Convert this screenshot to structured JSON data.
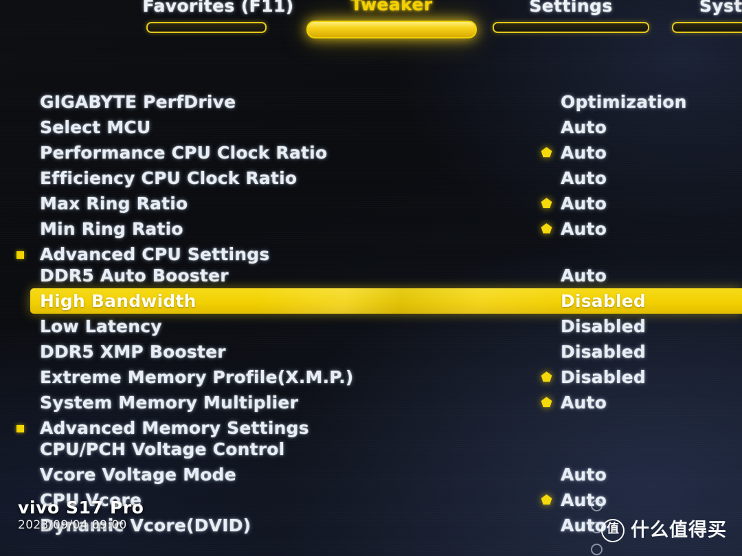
{
  "theme": {
    "accent": "#f2d000",
    "text": "#e9eef4",
    "background": "#0b0d12",
    "selected_row_bg": "#f2d000",
    "selected_row_text": "#fffef2"
  },
  "tabs": [
    {
      "label": "Favorites (F11)",
      "active": false
    },
    {
      "label": "Tweaker",
      "active": true
    },
    {
      "label": "Settings",
      "active": false
    },
    {
      "label": "Syste",
      "active": false
    }
  ],
  "rows": [
    {
      "label": "GIGABYTE PerfDrive",
      "value": "Optimization",
      "star": false,
      "bullet": false,
      "selected": false
    },
    {
      "label": "Select MCU",
      "value": "Auto",
      "star": false,
      "bullet": false,
      "selected": false
    },
    {
      "label": "Performance CPU Clock Ratio",
      "value": "Auto",
      "star": true,
      "bullet": false,
      "selected": false
    },
    {
      "label": "Efficiency CPU Clock Ratio",
      "value": "Auto",
      "star": false,
      "bullet": false,
      "selected": false
    },
    {
      "label": "Max Ring Ratio",
      "value": "Auto",
      "star": true,
      "bullet": false,
      "selected": false
    },
    {
      "label": "Min Ring Ratio",
      "value": "Auto",
      "star": true,
      "bullet": false,
      "selected": false
    },
    {
      "label": "Advanced CPU Settings",
      "value": "",
      "star": false,
      "bullet": true,
      "selected": false
    },
    {
      "label": "DDR5 Auto Booster",
      "value": "Auto",
      "star": false,
      "bullet": false,
      "selected": false
    },
    {
      "label": "High Bandwidth",
      "value": "Disabled",
      "star": false,
      "bullet": false,
      "selected": true
    },
    {
      "label": "Low Latency",
      "value": "Disabled",
      "star": false,
      "bullet": false,
      "selected": false
    },
    {
      "label": "DDR5 XMP Booster",
      "value": "Disabled",
      "star": false,
      "bullet": false,
      "selected": false
    },
    {
      "label": "Extreme Memory Profile(X.M.P.)",
      "value": "Disabled",
      "star": true,
      "bullet": false,
      "selected": false
    },
    {
      "label": "System Memory Multiplier",
      "value": "Auto",
      "star": true,
      "bullet": false,
      "selected": false
    },
    {
      "label": "Advanced Memory Settings",
      "value": "",
      "star": false,
      "bullet": true,
      "selected": false
    },
    {
      "label": "CPU/PCH Voltage Control",
      "value": "",
      "star": false,
      "bullet": false,
      "selected": false
    },
    {
      "label": "Vcore Voltage Mode",
      "value": "Auto",
      "star": false,
      "bullet": false,
      "selected": false
    },
    {
      "label": "CPU Vcore",
      "value": "Auto",
      "star": true,
      "bullet": false,
      "selected": false
    },
    {
      "label": "Dynamic Vcore(DVID)",
      "value": "Auto",
      "star": false,
      "bullet": false,
      "selected": false
    }
  ],
  "camera_watermark": {
    "model": "vivo S17 Pro",
    "timestamp": "2023/09/04 09:00"
  },
  "brand_watermark": {
    "mark": "值",
    "text": "什么值得买"
  },
  "icons": {
    "star": "favorite-star-icon",
    "bullet": "submenu-bullet-icon"
  }
}
